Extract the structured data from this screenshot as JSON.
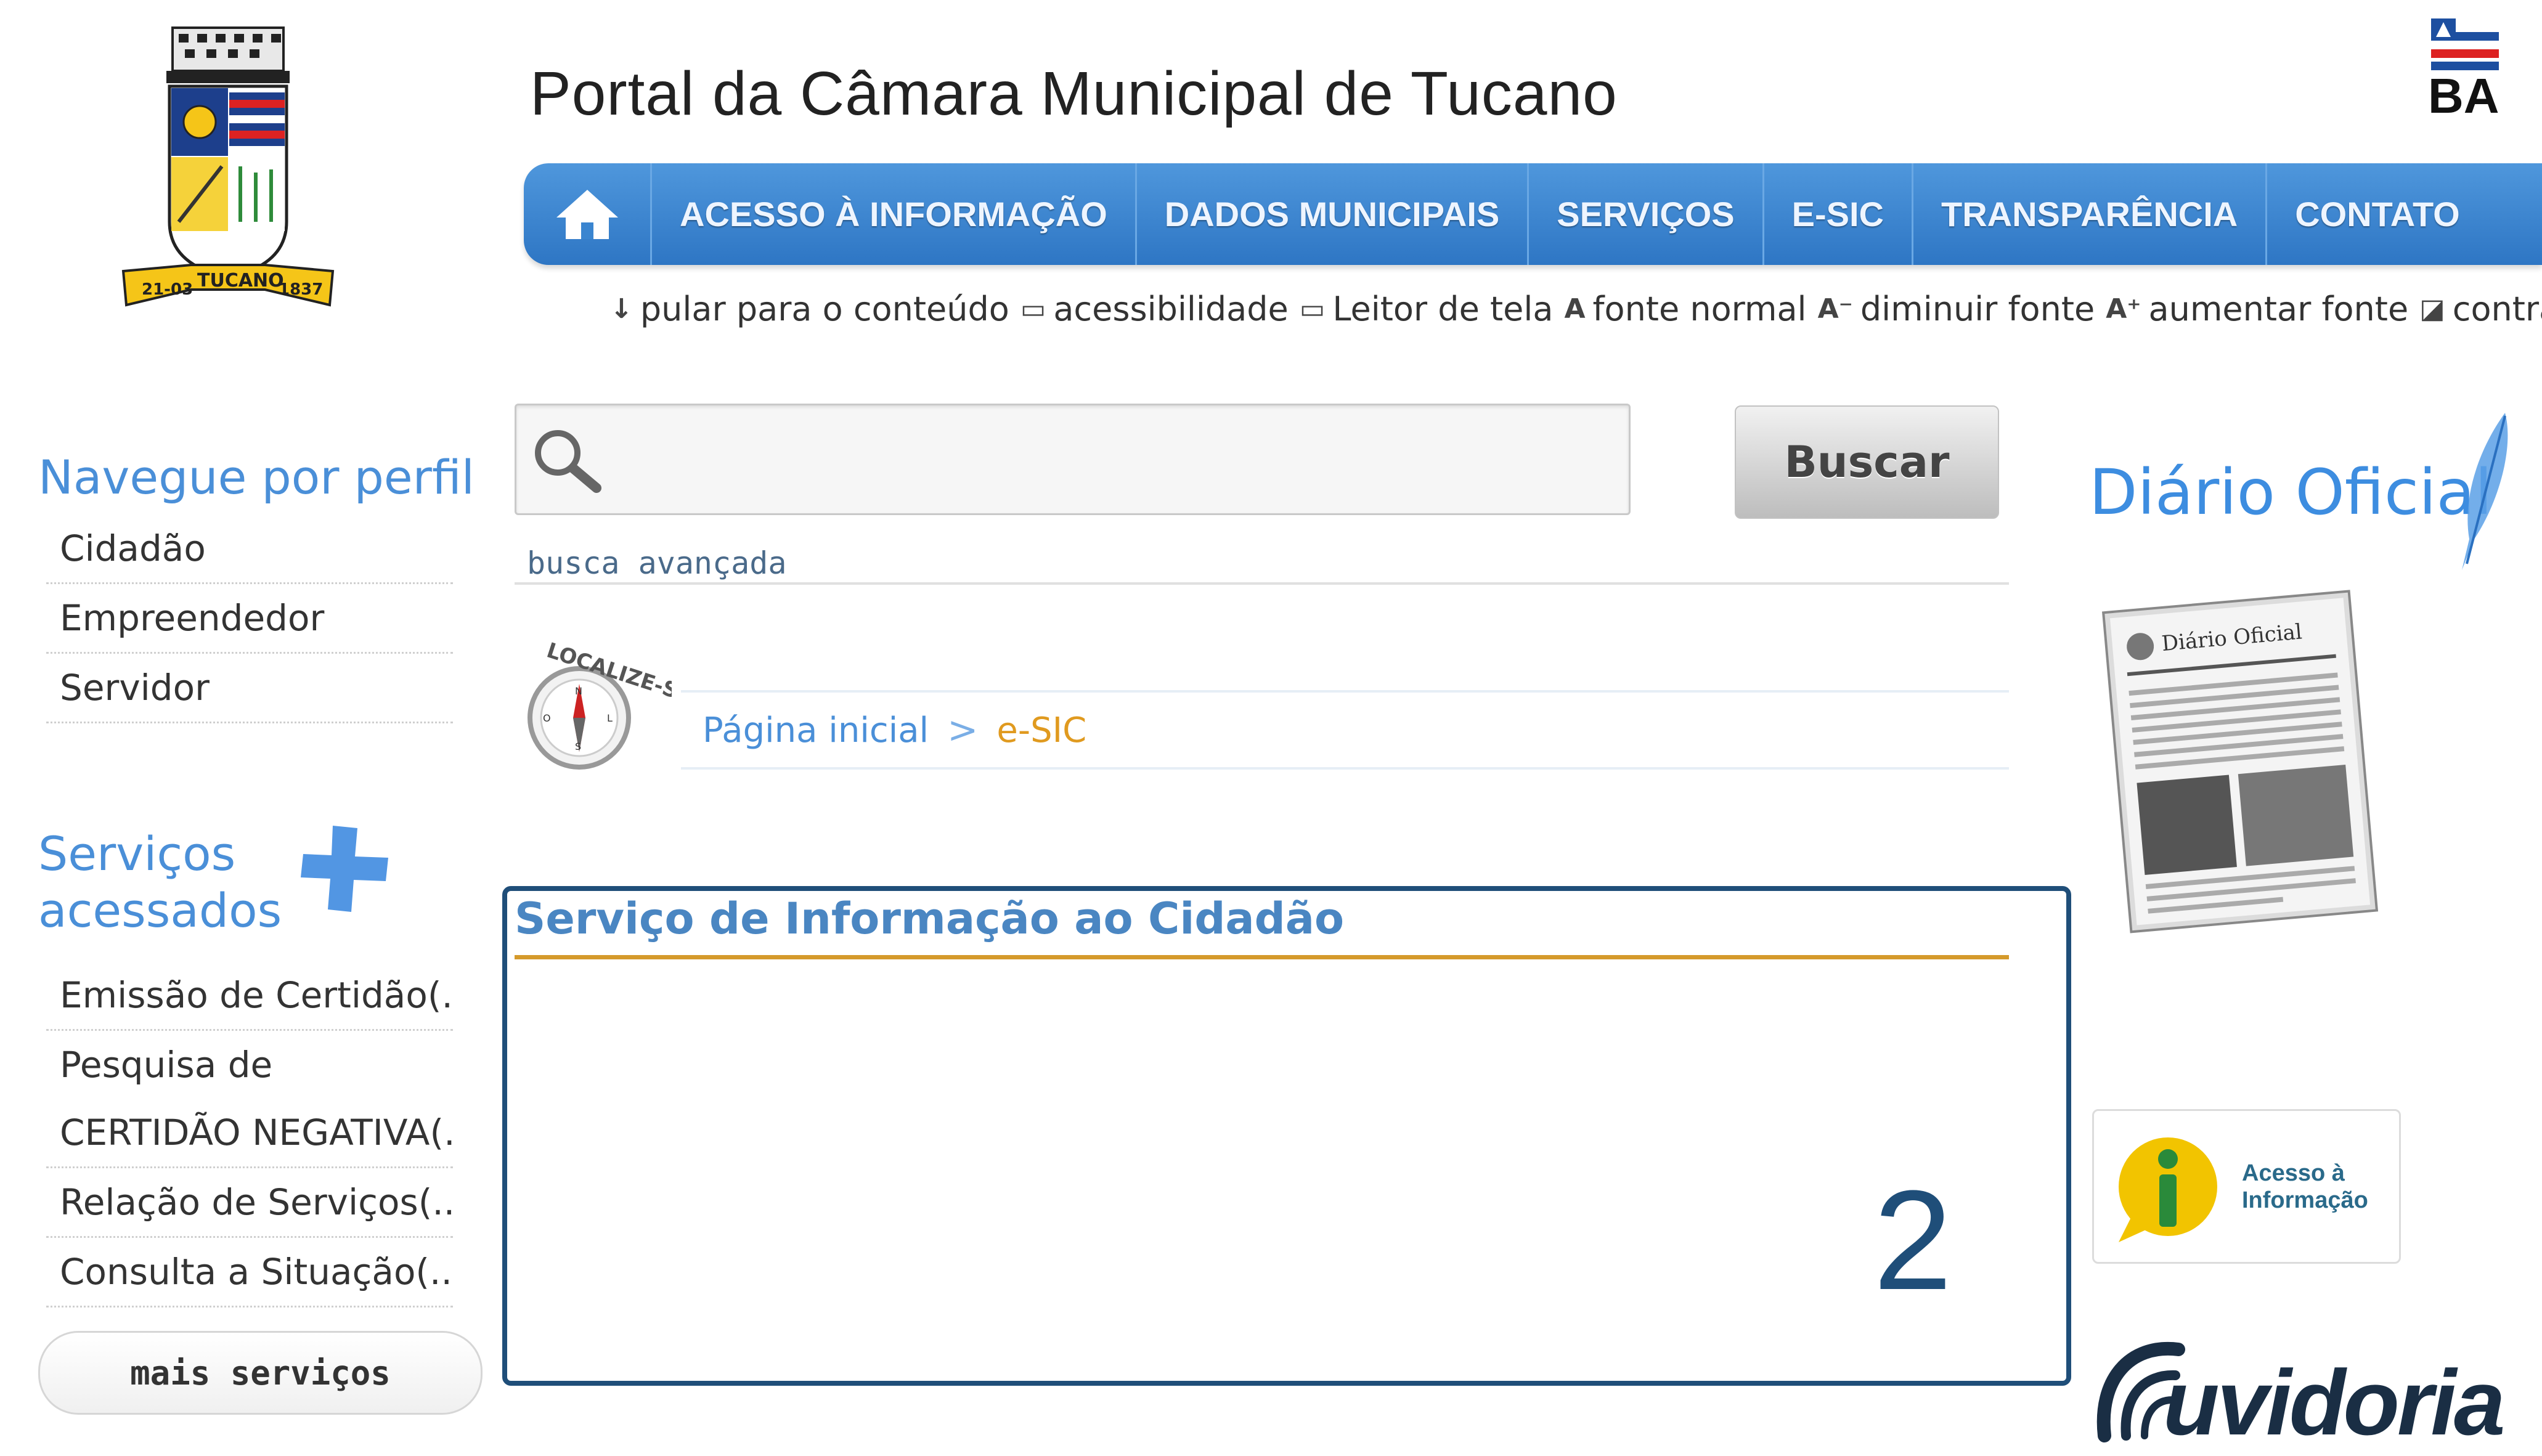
{
  "header": {
    "title": "Portal da Câmara Municipal de Tucano",
    "state_badge": "BA",
    "coat_of_arms": {
      "ribbon_left": "21-03",
      "ribbon_center": "TUCANO",
      "ribbon_right": "1837"
    }
  },
  "nav": {
    "home_icon": "home-icon",
    "items": [
      {
        "label": "ACESSO À INFORMAÇÃO"
      },
      {
        "label": "DADOS MUNICIPAIS"
      },
      {
        "label": "SERVIÇOS"
      },
      {
        "label": "E-SIC"
      },
      {
        "label": "TRANSPARÊNCIA"
      },
      {
        "label": "CONTATO"
      }
    ]
  },
  "accessibility": {
    "skip": "pular para o conteúdo",
    "accessibility": "acessibilidade",
    "screen_reader": "Leitor de tela",
    "normal_font": "fonte normal",
    "decrease_font": "diminuir fonte",
    "increase_font": "aumentar fonte",
    "contrast": "contraste",
    "icons": {
      "skip": "↓",
      "accessibility": "▭",
      "screen_reader": "▭",
      "normal_font": "A",
      "decrease_font": "A⁻",
      "increase_font": "A⁺",
      "contrast": "◪"
    }
  },
  "sidebar": {
    "profile_heading": "Navegue por perfil",
    "profiles": [
      "Cidadão",
      "Empreendedor",
      "Servidor"
    ],
    "services_heading_line1": "Serviços",
    "services_heading_line2": "acessados",
    "services": [
      "Emissão de Certidão(...)",
      "Pesquisa de",
      "CERTIDÃO NEGATIVA(...)",
      "Relação de Serviços(...)",
      "Consulta a Situação(...)"
    ],
    "more_button": "mais serviços"
  },
  "search": {
    "input_value": "",
    "button": "Buscar",
    "advanced": "busca avançada"
  },
  "breadcrumb": {
    "badge": "LOCALIZE-SE",
    "home": "Página inicial",
    "separator": ">",
    "current": "e-SIC"
  },
  "main": {
    "title": "Serviço de Informação ao Cidadão",
    "marker_number": "2"
  },
  "right": {
    "diario_title": "Diário Oficial",
    "newspaper_title": "Diário Oficial",
    "acesso_line1": "Acesso à",
    "acesso_line2": "Informação",
    "ouvidoria": "uvidoria"
  },
  "colors": {
    "nav_blue": "#3a85d0",
    "link_blue": "#4a8fd8",
    "accent_orange": "#e09a1f",
    "panel_border": "#1f4e79"
  }
}
